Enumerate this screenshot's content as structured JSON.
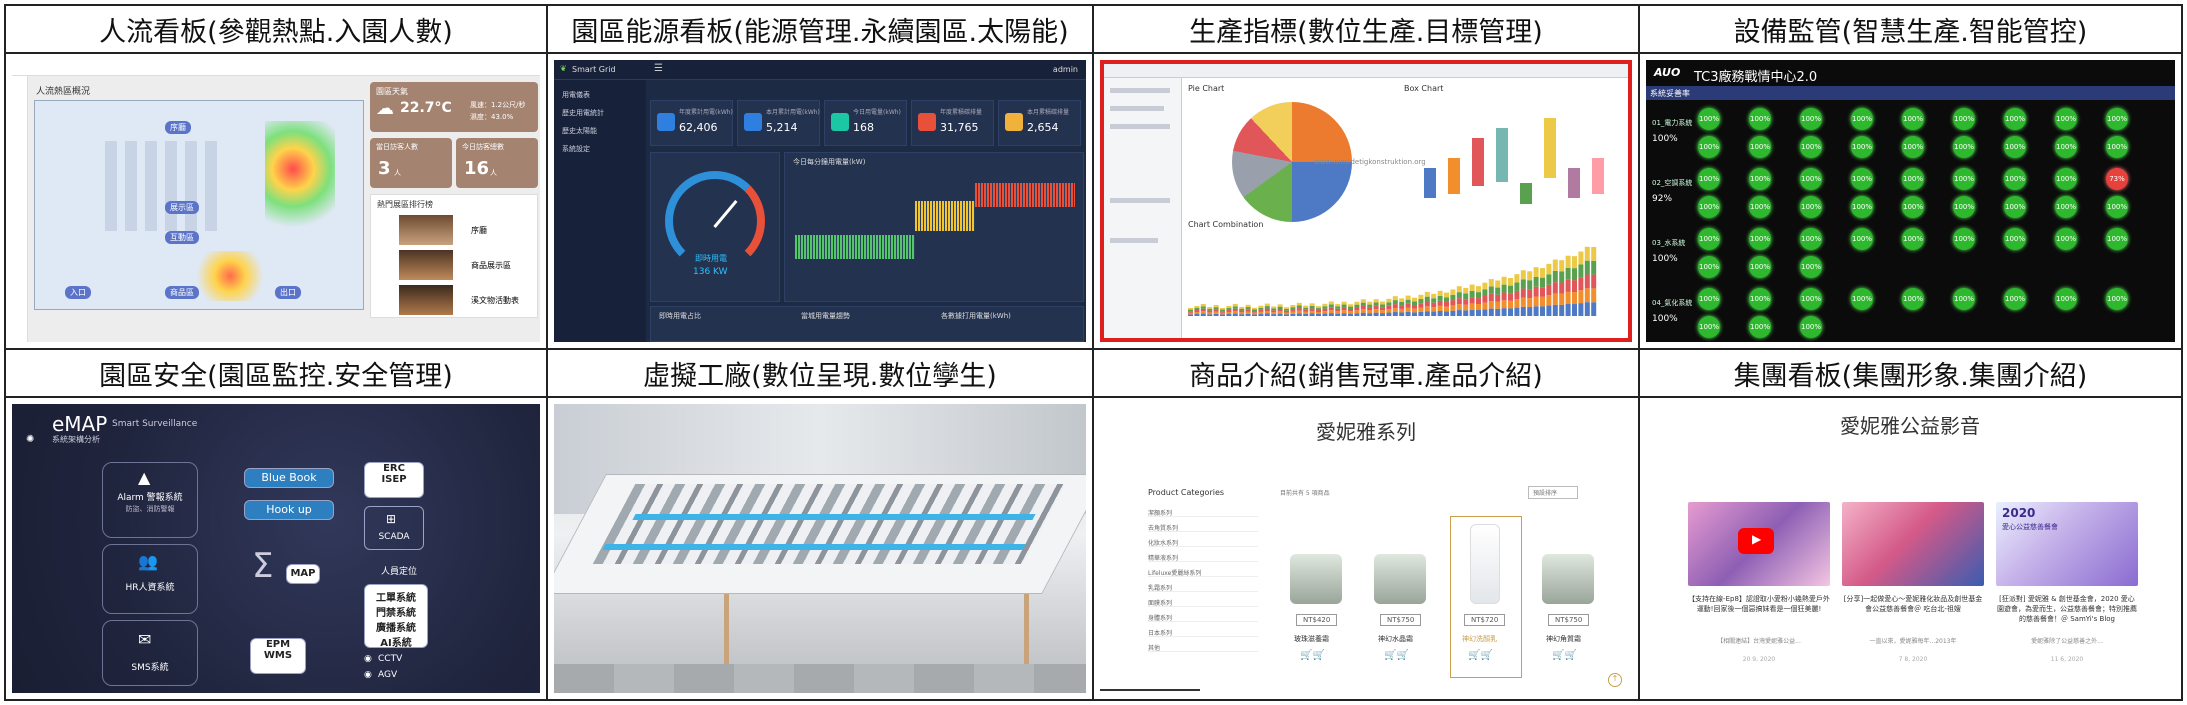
{
  "headers": [
    "人流看板(參觀熱點.入園人數)",
    "園區能源看板(能源管理.永續園區.太陽能)",
    "生產指標(數位生產.目標管理)",
    "設備監管(智慧生產.智能管控)",
    "園區安全(園區監控.安全管理)",
    "虛擬工廠(數位呈現.數位孿生)",
    "商品介紹(銷售冠軍.產品介紹)",
    "集團看板(集團形象.集團介紹)"
  ],
  "p1": {
    "title": "人流熱區概況",
    "weather_label": "園區天氣",
    "temp": "22.7°C",
    "wind": "風速：1.2公尺/秒",
    "humidity": "濕度：43.0%",
    "visitors_label": "當日訪客人數",
    "visitors": "3",
    "today_label": "今日訪客總數",
    "today": "16",
    "unit": "人",
    "rank_title": "熱門展區排行榜",
    "rank": [
      "序廳",
      "商品展示區",
      "溪文物活動表"
    ]
  },
  "p2": {
    "brand": "Smart Grid",
    "user": "admin",
    "menu": [
      "用電儀表",
      "歷史用電統計",
      "歷史太陽能",
      "系統設定"
    ],
    "kpis": [
      {
        "label": "年度累計用電(kWh)",
        "value": "62,406",
        "color": "#2f7fe0"
      },
      {
        "label": "本月累計用電(kWh)",
        "value": "5,214",
        "color": "#2f7fe0"
      },
      {
        "label": "今日用電量(kWh)",
        "value": "168",
        "color": "#1cc7a4"
      },
      {
        "label": "年度累積碳排量",
        "value": "31,765",
        "color": "#e8503a"
      },
      {
        "label": "本月累積碳排量",
        "value": "2,654",
        "color": "#f0b23a"
      }
    ],
    "gauge_label": "即時用電",
    "gauge_value": "136 KW",
    "chart_title": "今日每分鐘用電量(kW)",
    "bottom": [
      "即時用電占比",
      "當城用電量趨勢",
      "各數據打用電量(kWh)"
    ]
  },
  "p3": {
    "chart1_title": "Pie Chart",
    "chart2_title": "Box Chart",
    "chart3_title": "Chart Combination",
    "watermark": "www.winsidetigkonstruktion.org"
  },
  "p4": {
    "brand": "AUO",
    "title": "TC3廠務戰情中心2.0",
    "section": "系統妥善率",
    "rows": [
      {
        "name": "01_電力系統",
        "pct": "100%"
      },
      {
        "name": "02_空調系統",
        "pct": "92%"
      },
      {
        "name": "03_水系統",
        "pct": "100%"
      },
      {
        "name": "04_氣化系統",
        "pct": "100%"
      }
    ],
    "dot_label": "100%",
    "alert_label": "73%"
  },
  "p5": {
    "title": "eMAP",
    "subtitle": "Smart Surveillance",
    "section": "系統架構分析",
    "alarm": "Alarm 警報系統",
    "alarm_sub": "防盜、消防警報",
    "hr": "HR人資系統",
    "sms": "SMS系統",
    "bluebook": "Blue Book",
    "hookup": "Hook up",
    "map": "MAP",
    "erc": "ERC",
    "isep": "ISEP",
    "scada": "SCADA",
    "personnel": "人員定位",
    "systems": [
      "工單系統",
      "門禁系統",
      "廣播系統",
      "AI系統"
    ],
    "epm": "EPM",
    "wms": "WMS",
    "cctv": "CCTV",
    "agv": "AGV"
  },
  "p7": {
    "title": "愛妮雅系列",
    "cat_title": "Product Categories",
    "cats": [
      "潔顏系列",
      "去角質系列",
      "化妝水系列",
      "精華液系列",
      "Lifeluxe愛麗絲系列",
      "乳霜系列",
      "面膜系列",
      "身體系列",
      "日本系列",
      "其他"
    ],
    "breadcrumb": "目前共有 5 項商品",
    "sort": "預設排序",
    "products": [
      {
        "name": "玻珠滋養霜",
        "price": "NT$420"
      },
      {
        "name": "神幻水晶霜",
        "price": "NT$750"
      },
      {
        "name": "神幻洗顏乳",
        "price": "NT$720"
      },
      {
        "name": "神幻角質霜",
        "price": "NT$750"
      }
    ]
  },
  "p8": {
    "title": "愛妮雅公益影音",
    "videos": [
      {
        "caption": "【支持在線-Ep8】認證取小愛粉小幾熱愛戶外運動!回家後一個惡搞妹看是一個狂美麗!",
        "meta": "【相關連結】台灣愛妮雅公益...",
        "date": "20 9, 2020"
      },
      {
        "caption": "[分享]一起做愛心～愛妮雅化妝品及創世基金會公益慈善餐會＠ 吃台北-祖嫂",
        "meta": "一直以來，愛妮雅每年...2013年",
        "date": "7 8, 2020"
      },
      {
        "caption": "[狂派對] 愛妮雅 & 創世基金會，2020 愛心園遊會，為愛而生，公益慈善餐會；特別推薦的慈善餐會！＠ SamYi's Blog",
        "meta": "愛妮雅除了公益慈善之外...",
        "date": "11 6, 2020"
      }
    ],
    "banner_year": "2020",
    "banner_text": "愛心公益慈善餐會"
  }
}
